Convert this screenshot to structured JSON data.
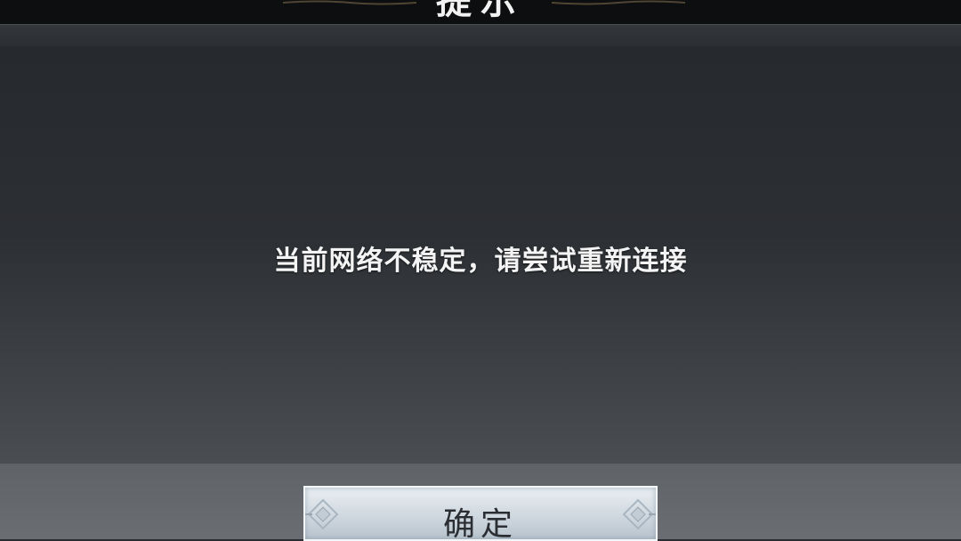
{
  "dialog": {
    "title": "提示",
    "message": "当前网络不稳定，请尝试重新连接",
    "confirm_label": "确定"
  },
  "icons": {
    "title_ornament": "decorative-flourish-icon",
    "button_ornament": "diamond-corner-icon"
  },
  "colors": {
    "title_bar": "#0d0e0f",
    "body_top": "#26292d",
    "body_bottom": "#4a4d51",
    "message_text": "#f4f4f4",
    "button_face": "#dce3e9"
  }
}
